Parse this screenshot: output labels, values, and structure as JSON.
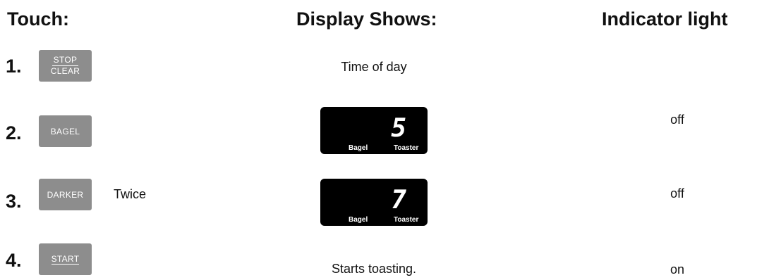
{
  "headers": {
    "touch": "Touch:",
    "display": "Display Shows:",
    "indicator": "Indicator light"
  },
  "steps": [
    {
      "number": "1.",
      "button": {
        "top": "STOP",
        "bottom": "CLEAR"
      },
      "note": "",
      "display_text": "Time of day",
      "indicator": ""
    },
    {
      "number": "2.",
      "button": {
        "label": "BAGEL"
      },
      "note": "",
      "display": {
        "digit": "5",
        "label_left": "Bagel",
        "label_right": "Toaster"
      },
      "indicator": "off"
    },
    {
      "number": "3.",
      "button": {
        "label": "DARKER"
      },
      "note": "Twice",
      "display": {
        "digit": "7",
        "label_left": "Bagel",
        "label_right": "Toaster"
      },
      "indicator": "off"
    },
    {
      "number": "4.",
      "button": {
        "label": "START"
      },
      "note": "",
      "display_text": "Starts toasting.",
      "indicator": "on"
    }
  ]
}
